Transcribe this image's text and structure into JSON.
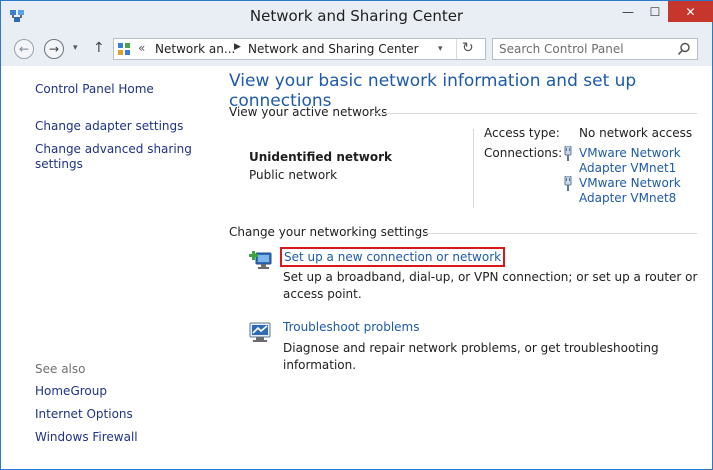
{
  "window": {
    "title": "Network and Sharing Center"
  },
  "titlebar": {
    "minimize": "—",
    "maximize": "☐",
    "close": "✕"
  },
  "navbar": {
    "back_glyph": "←",
    "forward_glyph": "→",
    "recent_glyph": "▾",
    "up_glyph": "↑",
    "address": {
      "prefix": "«",
      "crumbs": [
        "Network an...",
        "Network and Sharing Center"
      ],
      "separator": "▶",
      "dropdown_glyph": "▾",
      "refresh_glyph": "↻"
    },
    "search": {
      "placeholder": "Search Control Panel",
      "value": ""
    }
  },
  "sidebar": {
    "links": [
      "Control Panel Home",
      "Change adapter settings",
      "Change advanced sharing settings"
    ],
    "see_also_heading": "See also",
    "see_also": [
      "HomeGroup",
      "Internet Options",
      "Windows Firewall"
    ]
  },
  "main": {
    "title": "View your basic network information and set up connections",
    "active_networks": {
      "heading": "View your active networks",
      "network_name": "Unidentified network",
      "network_category": "Public network",
      "access_type_label": "Access type:",
      "access_type_value": "No network access",
      "connections_label": "Connections:",
      "connections": [
        "VMware Network Adapter VMnet1",
        "VMware Network Adapter VMnet8"
      ]
    },
    "networking_settings": {
      "heading": "Change your networking settings",
      "tasks": [
        {
          "link": "Set up a new connection or network",
          "description": "Set up a broadband, dial-up, or VPN connection; or set up a router or access point.",
          "icon": "new-connection-icon"
        },
        {
          "link": "Troubleshoot problems",
          "description": "Diagnose and repair network problems, or get troubleshooting information.",
          "icon": "troubleshoot-icon"
        }
      ]
    }
  },
  "colors": {
    "link": "#1e5aa8",
    "sidebar_link": "#1e3287",
    "title_blue": "#1e5aa8",
    "close_button": "#c7362c",
    "highlight_box": "#d7191e",
    "chrome": "#e9eef4"
  }
}
